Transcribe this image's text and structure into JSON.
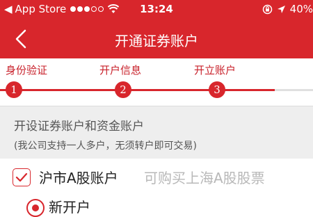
{
  "status_bar": {
    "back_glyph": "◀",
    "carrier": "App Store",
    "time": "13:24",
    "battery": "40%",
    "icons": [
      "signal-dots-icon",
      "wifi-icon",
      "orientation-lock-icon",
      "location-icon",
      "battery-icon"
    ]
  },
  "navbar": {
    "title": "开通证券账户",
    "back_icon": "chevron-left-icon"
  },
  "steps": [
    {
      "label": "身份验证",
      "number": "1"
    },
    {
      "label": "开户信息",
      "number": "2"
    },
    {
      "label": "开立账户",
      "number": "3"
    }
  ],
  "section": {
    "title": "开设证券账户和资金账户",
    "subtitle": "(我公司支持一人多户，无须转户即可交易)"
  },
  "options": [
    {
      "label": "沪市A股账户",
      "description": "可购买上海A股股票",
      "checked": true
    }
  ],
  "radio": {
    "label": "新开户",
    "selected": true
  },
  "colors": {
    "brand_red": "#d8262c",
    "section_bg": "#eeeeee",
    "muted_text": "#b8b8b8"
  }
}
